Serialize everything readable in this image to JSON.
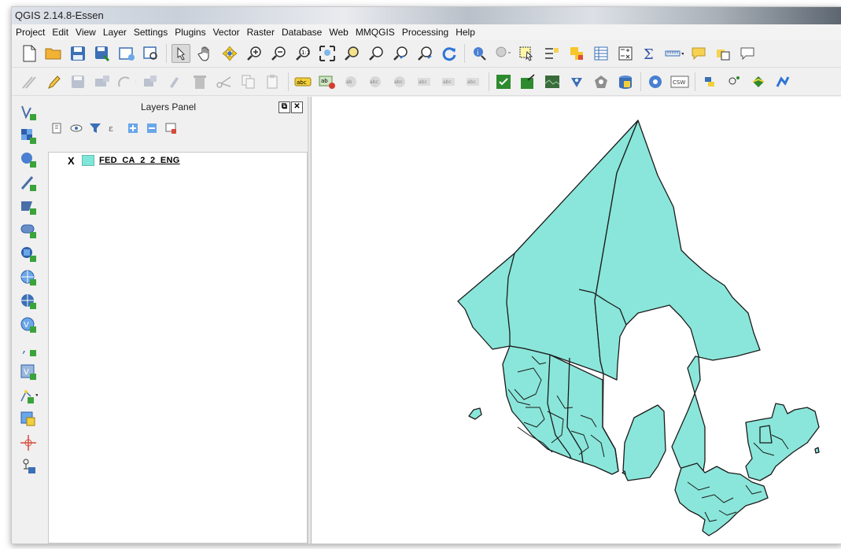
{
  "window": {
    "title": "QGIS 2.14.8-Essen"
  },
  "menu": [
    "Project",
    "Edit",
    "View",
    "Layer",
    "Settings",
    "Plugins",
    "Vector",
    "Raster",
    "Database",
    "Web",
    "MMQGIS",
    "Processing",
    "Help"
  ],
  "layers_panel": {
    "title": "Layers Panel",
    "layers": [
      {
        "name": "FED_CA_2_2_ENG",
        "checked_mark": "X",
        "swatch_color": "#7fe6d9"
      }
    ]
  },
  "map": {
    "fill_color": "#8ae6da",
    "stroke_color": "#1b1b1b"
  },
  "toolbar_icons_row1": [
    "new-project-icon",
    "open-project-icon",
    "save-project-icon",
    "save-as-icon",
    "new-print-composer-icon",
    "composer-manager-icon",
    "touch-zoom-icon",
    "pan-icon",
    "pan-to-selection-icon",
    "zoom-in-icon",
    "zoom-out-icon",
    "zoom-native-icon",
    "zoom-full-icon",
    "zoom-to-selection-icon",
    "zoom-to-layer-icon",
    "zoom-last-icon",
    "zoom-next-icon",
    "refresh-icon",
    "identify-icon",
    "action-icon",
    "select-icon",
    "deselect-icon",
    "select-by-expression-icon",
    "attribute-table-icon",
    "field-calculator-icon",
    "statistics-icon",
    "measure-icon",
    "annotation-icon",
    "text-annotation-icon"
  ],
  "toolbar_icons_row2": [
    "current-edits-icon",
    "toggle-editing-icon",
    "save-edits-icon",
    "add-feature-icon",
    "move-feature-icon",
    "node-tool-icon",
    "delete-selected-icon",
    "cut-icon",
    "copy-icon",
    "paste-icon",
    "label-abc-icon",
    "layer-labeling-icon",
    "pin-labels-icon",
    "highlight-labels-icon",
    "move-label-icon",
    "rotate-label-icon",
    "change-label-icon",
    "grass-icon",
    "grass-tools-icon",
    "georeferencer-icon",
    "heatmap-icon",
    "db-manager-icon",
    "coordinate-capture-icon",
    "metasearch-icon",
    "csw-icon",
    "python-icon",
    "plugin-icon",
    "plugin2-icon",
    "plugin3-icon"
  ],
  "left_toolbar_icons": [
    "add-vector-layer-icon",
    "add-raster-layer-icon",
    "add-postgis-layer-icon",
    "add-spatialite-layer-icon",
    "add-mssql-layer-icon",
    "add-oracle-layer-icon",
    "add-db2-layer-icon",
    "add-wms-layer-icon",
    "add-wcs-layer-icon",
    "add-wfs-layer-icon",
    "add-delimited-text-icon",
    "add-virtual-layer-icon",
    "new-shapefile-icon",
    "offline-editing-icon",
    "coordinate-capture-tool-icon",
    "plugin-add-icon"
  ]
}
